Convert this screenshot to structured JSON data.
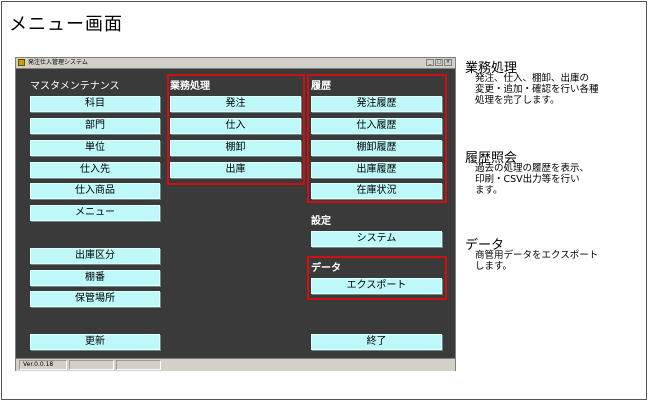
{
  "page_title": "メニュー画面",
  "window": {
    "title": "発注仕入管理システム",
    "controls": [
      "_",
      "□",
      "×"
    ],
    "status": {
      "version": "Ver.0.0.18",
      "cell2": "",
      "cell3": ""
    }
  },
  "master": {
    "label": "マスタメンテナンス",
    "items": [
      "科目",
      "部門",
      "単位",
      "仕入先",
      "仕入商品",
      "メニュー"
    ],
    "items2": [
      "出庫区分",
      "棚番",
      "保管場所"
    ],
    "update": "更新"
  },
  "business": {
    "label": "業務処理",
    "items": [
      "発注",
      "仕入",
      "棚卸",
      "出庫"
    ]
  },
  "history": {
    "label": "履歴",
    "items": [
      "発注履歴",
      "仕入履歴",
      "棚卸履歴",
      "出庫履歴",
      "在庫状況"
    ]
  },
  "settings": {
    "label": "設定",
    "system": "システム"
  },
  "data": {
    "label": "データ",
    "export": "エクスポート"
  },
  "exit": "終了",
  "notes": [
    {
      "title": "業務処理",
      "body": "発注、仕入、棚卸、出庫の\n変更・追加・確認を行い各種\n処理を完了します。"
    },
    {
      "title": "履歴照会",
      "body": "過去の処理の履歴を表示、\n印刷・CSV出力等を行い\nます。"
    },
    {
      "title": "データ",
      "body": "商管用データをエクスポート\nします。"
    }
  ],
  "colors": {
    "button_bg": "#bff8f8",
    "window_bg": "#3a3a3a",
    "highlight": "#d01010"
  }
}
